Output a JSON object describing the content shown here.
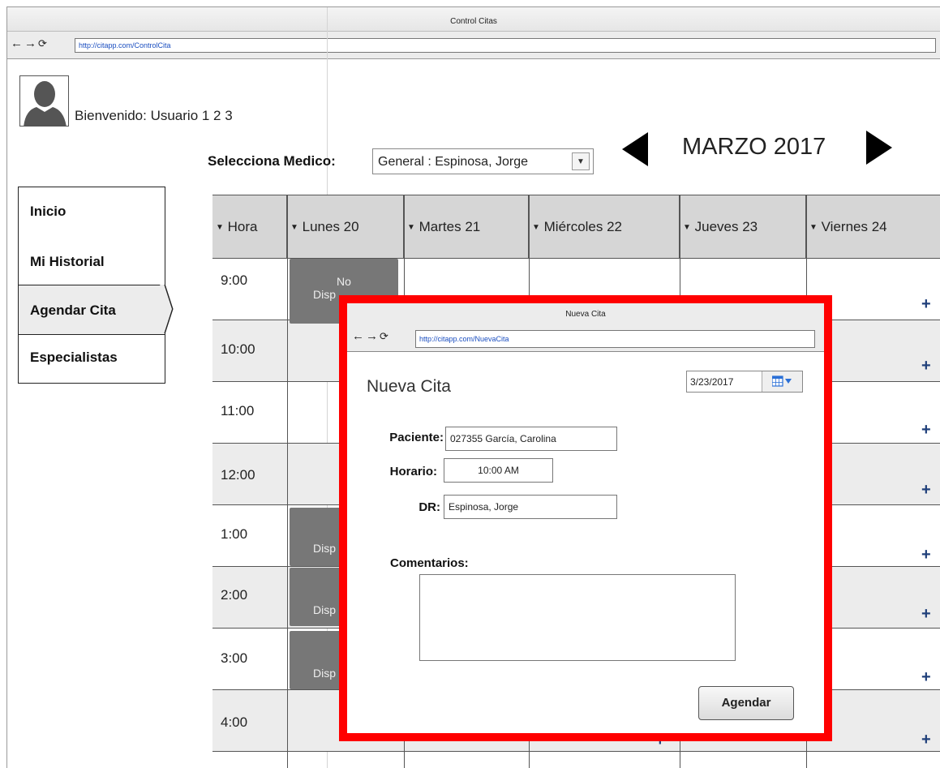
{
  "browser": {
    "title": "Control Citas",
    "nav_icons": [
      "back-arrow-icon",
      "forward-arrow-icon",
      "reload-icon"
    ],
    "url": "http://citapp.com/ControlCita"
  },
  "user": {
    "welcome": "Bienvenido: Usuario 1 2 3"
  },
  "doctor_select": {
    "label": "Selecciona Medico:",
    "value": "General : Espinosa, Jorge"
  },
  "calendar": {
    "month": "MARZO 2017",
    "headers": [
      "Hora",
      "Lunes 20",
      "Martes 21",
      "Miércoles 22",
      "Jueves 23",
      "Viernes 24"
    ],
    "times": [
      "9:00",
      "10:00",
      "11:00",
      "12:00",
      "1:00",
      "2:00",
      "3:00",
      "4:00"
    ],
    "no_disponible_line1": "No",
    "no_disponible_line2": "Disp",
    "add_symbol": "+"
  },
  "menu": {
    "items": [
      "Inicio",
      "Mi Historial",
      "Agendar Cita",
      "Especialistas"
    ],
    "active": "Agendar Cita"
  },
  "modal": {
    "window_title": "Nueva Cita",
    "url": "http://citapp.com/NuevaCita",
    "heading": "Nueva Cita",
    "date": "3/23/2017",
    "paciente_label": "Paciente:",
    "paciente_value": "027355 García, Carolina",
    "horario_label": "Horario:",
    "horario_value": "10:00 AM",
    "dr_label": "DR:",
    "dr_value": "Espinosa, Jorge",
    "comentarios_label": "Comentarios:",
    "comentarios_value": "",
    "submit_label": "Agendar"
  },
  "colors": {
    "modal_border": "#ff0000",
    "header_bg": "#d6d6d6",
    "unavailable_bg": "#777777",
    "plus_color": "#1f3f7a",
    "url_color": "#1a4ec0"
  }
}
